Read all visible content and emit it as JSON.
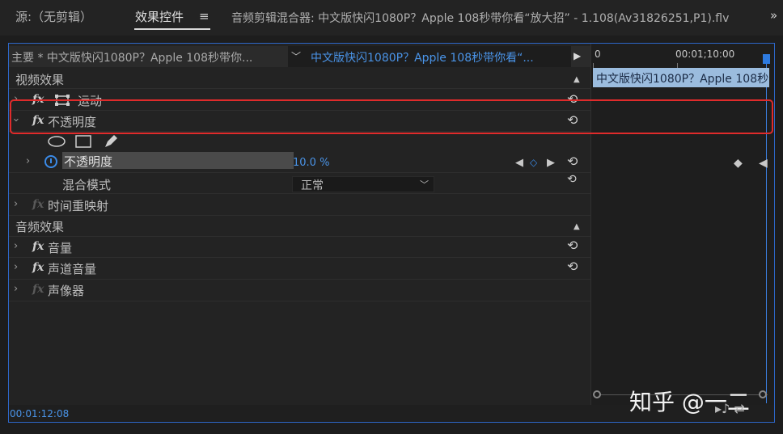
{
  "tabs": {
    "source": "源:（无剪辑）",
    "effect_controls": "效果控件",
    "menu": "≡",
    "audio_mixer": "音频剪辑混合器: 中文版快闪1080P？Apple 108秒带你看“放大招” - 1.108(Av31826251,P1).flv",
    "more": "»"
  },
  "clip_header": {
    "master": "主要 * 中文版快闪1080P？Apple 108秒带你...",
    "clip_name": "中文版快闪1080P？Apple 108秒带你看“...",
    "dropdown_icon": "chevron-down-icon",
    "play_icon": "play-icon"
  },
  "timeline": {
    "zero": "0",
    "time": "00:01;10:00",
    "clip_block": "中文版快闪1080P？Apple 108秒"
  },
  "video_section": {
    "title": "视频效果",
    "motion": "运动",
    "opacity_group": "不透明度",
    "opacity_param": "不透明度",
    "opacity_value": "10.0 %",
    "blend_mode": "混合模式",
    "blend_value": "正常",
    "time_remap": "时间重映射"
  },
  "audio_section": {
    "title": "音频效果",
    "volume": "音量",
    "channel_volume": "声道音量",
    "panner": "声像器"
  },
  "fx_label": "fx",
  "reset_glyph": "⟲",
  "footer": {
    "timecode": "00:01:12:08",
    "watermark": "知乎 @一二"
  },
  "colors": {
    "accent_blue": "#3b8be8",
    "highlight_red": "#e02b2b",
    "clip_blue": "#9bbcde"
  }
}
